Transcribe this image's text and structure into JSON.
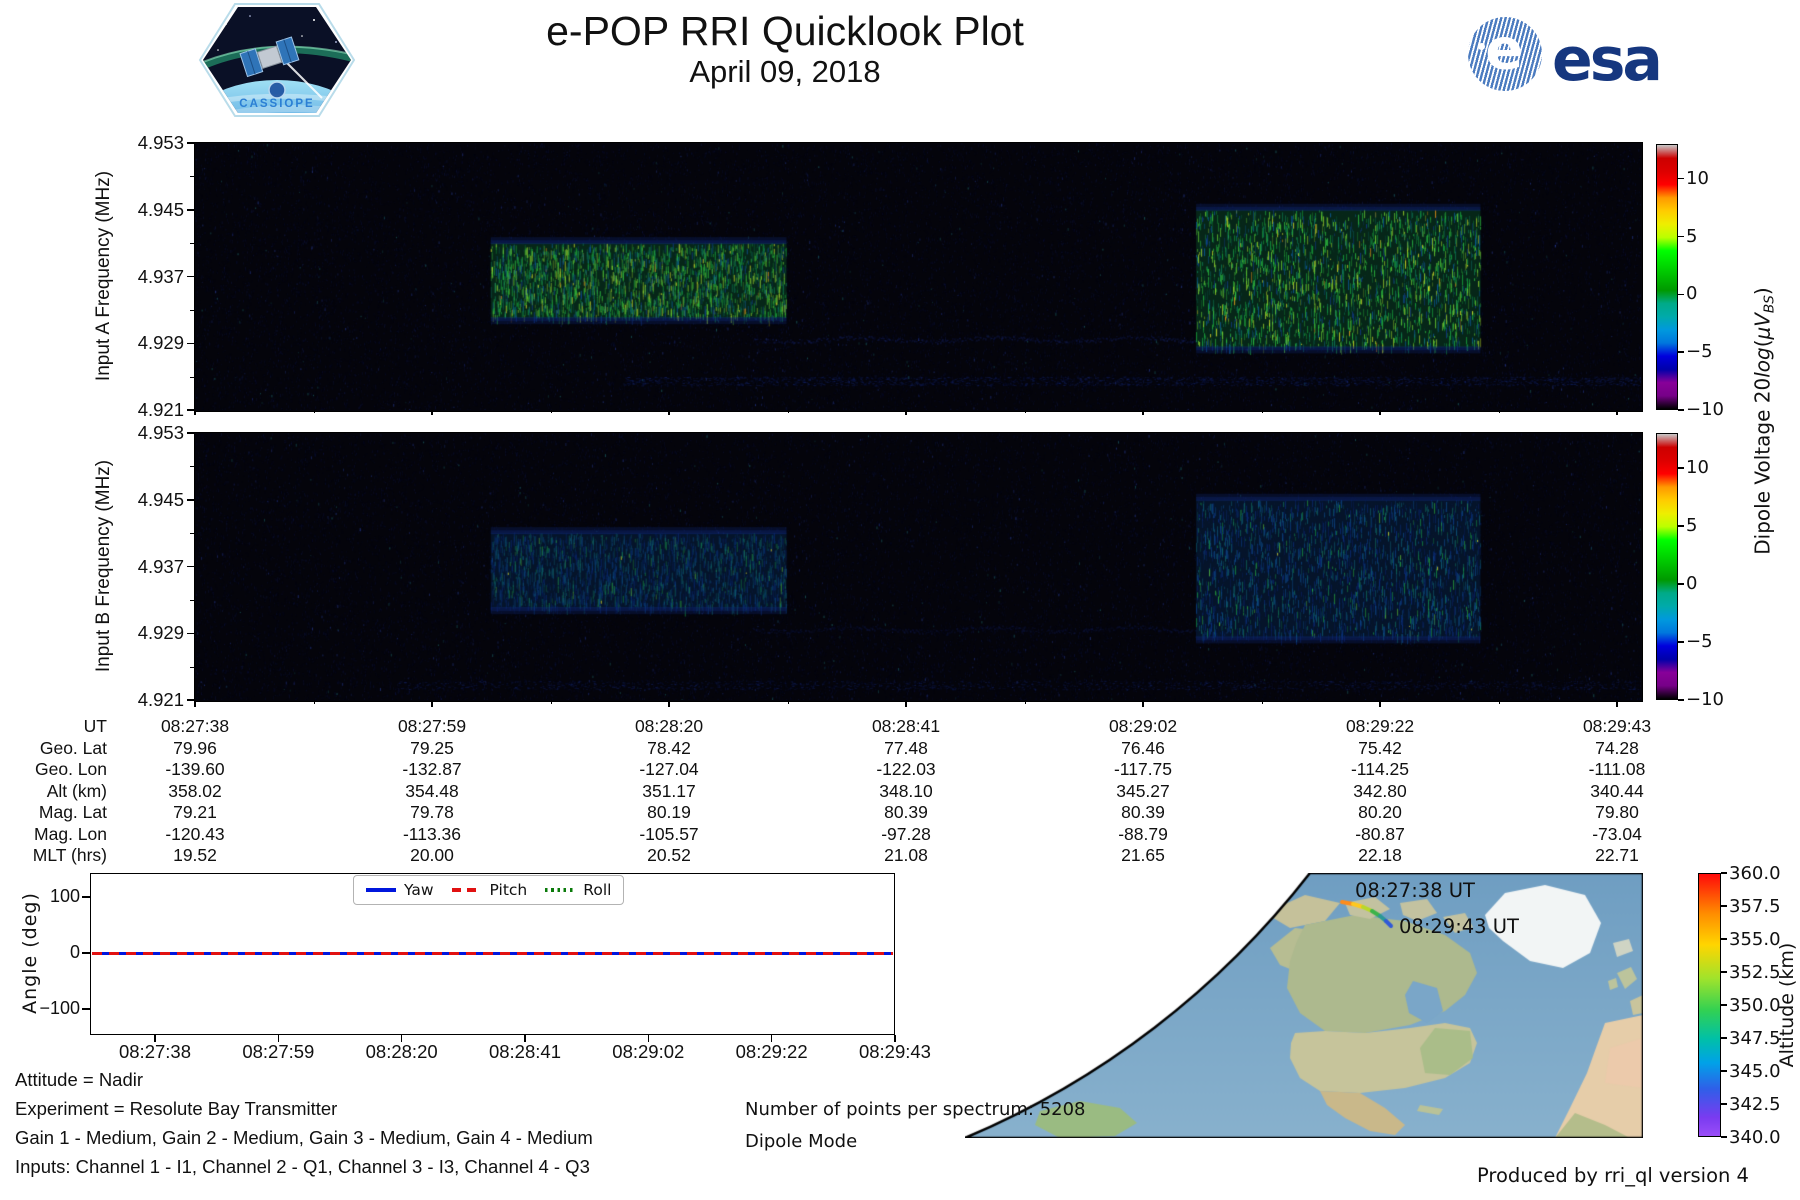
{
  "header": {
    "title": "e-POP RRI Quicklook Plot",
    "date": "April 09, 2018",
    "cassiope_label": "CASSIOPE",
    "esa_label": "esa",
    "esa_ball_letter": "e"
  },
  "time_ticks": [
    "08:27:38",
    "08:27:59",
    "08:28:20",
    "08:28:41",
    "08:29:02",
    "08:29:22",
    "08:29:43"
  ],
  "chart_data": [
    {
      "id": "spectrogram_input_a",
      "type": "heatmap",
      "ylabel": "Input A Frequency (MHz)",
      "yticks": [
        "4.953",
        "4.945",
        "4.937",
        "4.929",
        "4.921"
      ],
      "ylim_mhz": [
        4.921,
        4.953
      ],
      "xticks": [
        "08:27:38",
        "08:27:59",
        "08:28:20",
        "08:28:41",
        "08:29:02",
        "08:29:22",
        "08:29:43"
      ],
      "colormap": "nipy_spectral",
      "background_db": -10,
      "bursts": [
        {
          "start_ut": "08:28:04",
          "end_ut": "08:28:30",
          "f_low_mhz": 4.932,
          "f_high_mhz": 4.941,
          "intensity": "bright green/yellow vertical streaks, ~0 to 8 dB"
        },
        {
          "start_ut": "08:29:06",
          "end_ut": "08:29:31",
          "f_low_mhz": 4.9285,
          "f_high_mhz": 4.945,
          "intensity": "bright green/yellow vertical streaks, taller band, ~0 to 10 dB"
        }
      ],
      "faint_trace": {
        "start_ut": "08:28:27",
        "end_ut": "08:29:06",
        "f_mhz": 4.9295,
        "intensity": "faint blue wavy trace ~ -7 dB"
      }
    },
    {
      "id": "spectrogram_input_b",
      "type": "heatmap",
      "ylabel": "Input B Frequency (MHz)",
      "yticks": [
        "4.953",
        "4.945",
        "4.937",
        "4.929",
        "4.921"
      ],
      "ylim_mhz": [
        4.921,
        4.953
      ],
      "xticks": [
        "08:27:38",
        "08:27:59",
        "08:28:20",
        "08:28:41",
        "08:29:02",
        "08:29:22",
        "08:29:43"
      ],
      "colormap": "nipy_spectral",
      "background_db": -10,
      "bursts": [
        {
          "start_ut": "08:28:04",
          "end_ut": "08:28:30",
          "f_low_mhz": 4.932,
          "f_high_mhz": 4.941,
          "intensity": "dim blue-green streaks, ~-6 to 0 dB"
        },
        {
          "start_ut": "08:29:06",
          "end_ut": "08:29:31",
          "f_low_mhz": 4.9285,
          "f_high_mhz": 4.945,
          "intensity": "dim blue-green streaks with sparse green/yellow flecks"
        }
      ],
      "faint_trace": {
        "start_ut": "08:28:27",
        "end_ut": "08:29:06",
        "f_mhz": 4.9295,
        "intensity": "very faint blue wavy trace"
      }
    },
    {
      "id": "dipole_voltage_colorbar",
      "type": "colorbar",
      "label_prefix": "Dipole Voltage 20",
      "label_log": "log",
      "label_open": "(",
      "label_mu": "μV",
      "label_sub": "BS",
      "label_close": ")",
      "ticks": [
        "10",
        "5",
        "0",
        "−5",
        "−10"
      ],
      "lim_db": [
        -10,
        13
      ],
      "colormap": "nipy_spectral"
    },
    {
      "id": "attitude_plot",
      "type": "line",
      "ylabel": "Angle (deg)",
      "yticks": [
        "100",
        "0",
        "−100"
      ],
      "ylim_deg": [
        -175,
        175
      ],
      "xticks": [
        "08:27:38",
        "08:27:59",
        "08:28:20",
        "08:28:41",
        "08:29:02",
        "08:29:22",
        "08:29:43"
      ],
      "legend_position": "upper center",
      "series": [
        {
          "name": "Yaw",
          "color": "#0016dd",
          "line_style": "solid",
          "value_deg": 0
        },
        {
          "name": "Pitch",
          "color": "#e11111",
          "line_style": "dashed",
          "value_deg": 0
        },
        {
          "name": "Roll",
          "color": "#0a7a0a",
          "line_style": "dotted",
          "value_deg": 0
        }
      ]
    },
    {
      "id": "ground_track_map",
      "type": "map",
      "region": "Globe view: North America, Greenland, North Atlantic, western Africa; globe limb at left",
      "track": {
        "start_label": "08:27:38 UT",
        "end_label": "08:29:43 UT",
        "start_alt_km": 358.02,
        "end_alt_km": 340.44,
        "colored_by": "altitude",
        "location": "short arc over the Canadian Arctic"
      },
      "colorbar": {
        "label": "Altitude (km)",
        "ticks": [
          "360.0",
          "357.5",
          "355.0",
          "352.5",
          "350.0",
          "347.5",
          "345.0",
          "342.5",
          "340.0"
        ],
        "lim_km": [
          340,
          360
        ],
        "colormap": "rainbow"
      }
    }
  ],
  "ephemeris": {
    "row_labels": [
      "UT",
      "Geo. Lat",
      "Geo. Lon",
      "Alt (km)",
      "Mag. Lat",
      "Mag. Lon",
      "MLT (hrs)"
    ],
    "columns": [
      [
        "08:27:38",
        "79.96",
        "-139.60",
        "358.02",
        "79.21",
        "-120.43",
        "19.52"
      ],
      [
        "08:27:59",
        "79.25",
        "-132.87",
        "354.48",
        "79.78",
        "-113.36",
        "20.00"
      ],
      [
        "08:28:20",
        "78.42",
        "-127.04",
        "351.17",
        "80.19",
        "-105.57",
        "20.52"
      ],
      [
        "08:28:41",
        "77.48",
        "-122.03",
        "348.10",
        "80.39",
        "-97.28",
        "21.08"
      ],
      [
        "08:29:02",
        "76.46",
        "-117.75",
        "345.27",
        "80.39",
        "-88.79",
        "21.65"
      ],
      [
        "08:29:22",
        "75.42",
        "-114.25",
        "342.80",
        "80.20",
        "-80.87",
        "22.18"
      ],
      [
        "08:29:43",
        "74.28",
        "-111.08",
        "340.44",
        "79.80",
        "-73.04",
        "22.71"
      ]
    ]
  },
  "footnotes": {
    "attitude": "Attitude = Nadir",
    "experiment": "Experiment = Resolute Bay Transmitter",
    "gains": "Gain 1 - Medium, Gain 2 - Medium, Gain 3 - Medium, Gain 4 - Medium",
    "inputs": "Inputs: Channel 1 - I1, Channel 2 - Q1, Channel 3 - I3, Channel 4 - Q3",
    "points_per_spectrum": "Number of points per spectrum: 5208",
    "mode": "Dipole Mode",
    "produced_by": "Produced by rri_ql version 4"
  }
}
